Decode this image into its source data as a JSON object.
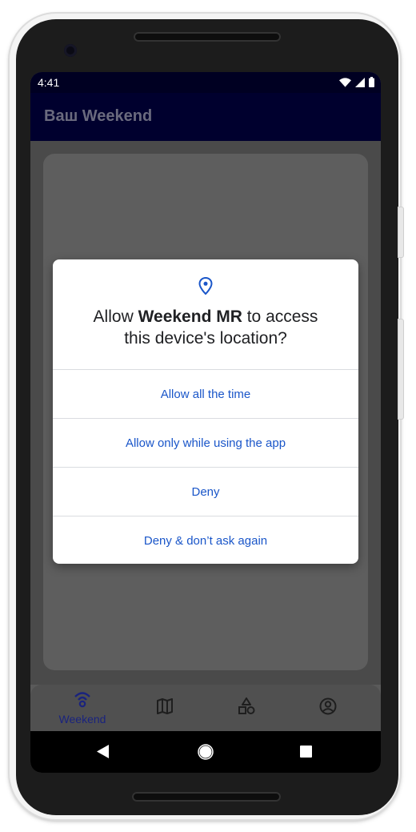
{
  "status_bar": {
    "time": "4:41",
    "icons": [
      "wifi-icon",
      "signal-icon",
      "battery-icon"
    ]
  },
  "app_bar": {
    "title": "Ваш Weekend"
  },
  "dialog": {
    "icon": "location-pin-icon",
    "title_prefix": "Allow ",
    "title_app": "Weekend MR",
    "title_suffix_line1": " to access",
    "title_line2": "this device's location?",
    "options": [
      "Allow all the time",
      "Allow only while using the app",
      "Deny",
      "Deny & don’t ask again"
    ]
  },
  "bottom_nav": {
    "items": [
      {
        "label": "Weekend",
        "icon": "broadcast-icon",
        "active": true
      },
      {
        "label": "",
        "icon": "map-icon"
      },
      {
        "label": "",
        "icon": "shapes-icon"
      },
      {
        "label": "",
        "icon": "account-circle-icon"
      }
    ]
  },
  "system_nav": [
    "back-icon",
    "home-icon",
    "recents-icon"
  ],
  "colors": {
    "accent": "#1a56c9",
    "app_bar": "#00002e",
    "active_nav": "#1a237e"
  }
}
